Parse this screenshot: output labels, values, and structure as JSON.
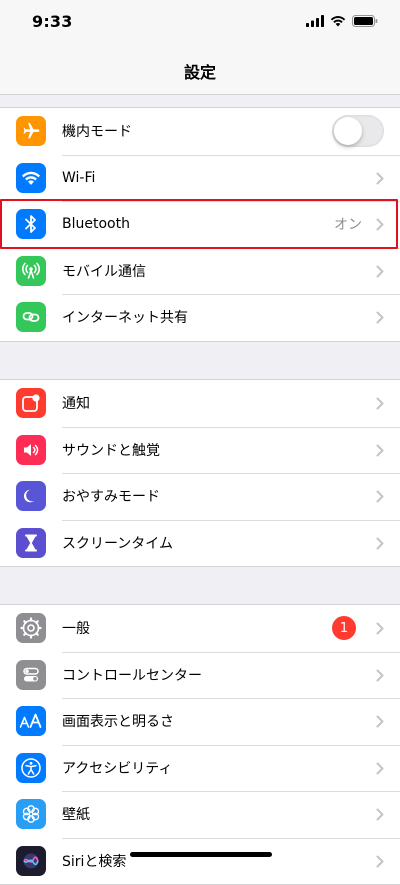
{
  "status": {
    "time": "9:33"
  },
  "nav": {
    "title": "設定"
  },
  "colors": {
    "orange": "#ff9500",
    "blue": "#007aff",
    "green": "#34c759",
    "red": "#ff3b30",
    "pink": "#ff2d55",
    "indigo": "#5856d6",
    "purple": "#5b4fcf",
    "gray": "#8e8e93",
    "highlight": "#e0101e"
  },
  "group1": [
    {
      "label": "機内モード",
      "icon": "airplane-icon",
      "control": "toggle",
      "toggle_on": false
    },
    {
      "label": "Wi-Fi",
      "icon": "wifi-icon"
    },
    {
      "label": "Bluetooth",
      "icon": "bluetooth-icon",
      "value": "オン"
    },
    {
      "label": "モバイル通信",
      "icon": "cellular-icon"
    },
    {
      "label": "インターネット共有",
      "icon": "hotspot-icon"
    }
  ],
  "group2": [
    {
      "label": "通知",
      "icon": "notifications-icon"
    },
    {
      "label": "サウンドと触覚",
      "icon": "speaker-icon"
    },
    {
      "label": "おやすみモード",
      "icon": "moon-icon"
    },
    {
      "label": "スクリーンタイム",
      "icon": "hourglass-icon"
    }
  ],
  "group3": [
    {
      "label": "一般",
      "icon": "gear-icon",
      "badge": "1"
    },
    {
      "label": "コントロールセンター",
      "icon": "switches-icon"
    },
    {
      "label": "画面表示と明るさ",
      "icon": "text-size-icon"
    },
    {
      "label": "アクセシビリティ",
      "icon": "accessibility-icon"
    },
    {
      "label": "壁紙",
      "icon": "wallpaper-icon"
    },
    {
      "label": "Siriと検索",
      "icon": "siri-icon"
    }
  ]
}
